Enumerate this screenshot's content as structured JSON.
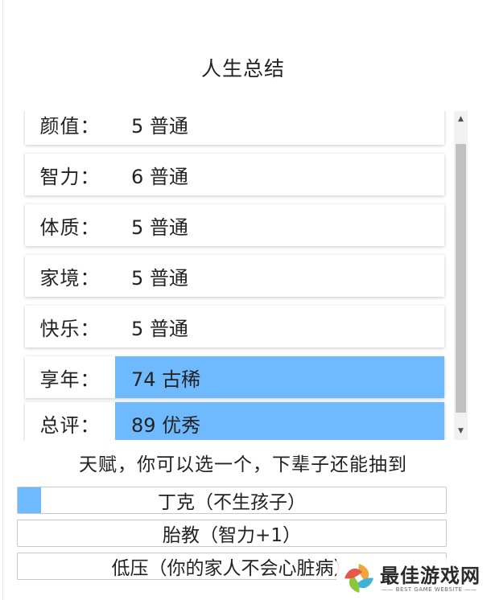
{
  "header": {
    "title": "人生总结"
  },
  "stats": [
    {
      "label": "颜值：",
      "value": "5 普通",
      "highlighted": false
    },
    {
      "label": "智力：",
      "value": "6 普通",
      "highlighted": false
    },
    {
      "label": "体质：",
      "value": "5 普通",
      "highlighted": false
    },
    {
      "label": "家境：",
      "value": "5 普通",
      "highlighted": false
    },
    {
      "label": "快乐：",
      "value": "5 普通",
      "highlighted": false
    },
    {
      "label": "享年：",
      "value": "74 古稀",
      "highlighted": true
    },
    {
      "label": "总评：",
      "value": "89 优秀",
      "highlighted": true
    }
  ],
  "talents": {
    "prompt": "天赋，你可以选一个，下辈子还能抽到",
    "options": [
      {
        "label": "丁克（不生孩子）",
        "selected": true
      },
      {
        "label": "胎教（智力+1）",
        "selected": false
      },
      {
        "label": "低压（你的家人不会心脏病）",
        "selected": false
      }
    ]
  },
  "watermark": {
    "name": "最佳游戏网",
    "tagline": "—— BEST GAME WEBSITE ——"
  },
  "colors": {
    "highlight": "#6fb9ff",
    "row_bg": "#ffffff",
    "scrollbar_thumb": "#c1c1c1",
    "scrollbar_track": "#f1f1f1"
  },
  "icons": {
    "scroll_up": "up-arrow-icon",
    "scroll_down": "down-arrow-icon",
    "watermark_logo": "interlocked-leaf-logo-icon"
  }
}
